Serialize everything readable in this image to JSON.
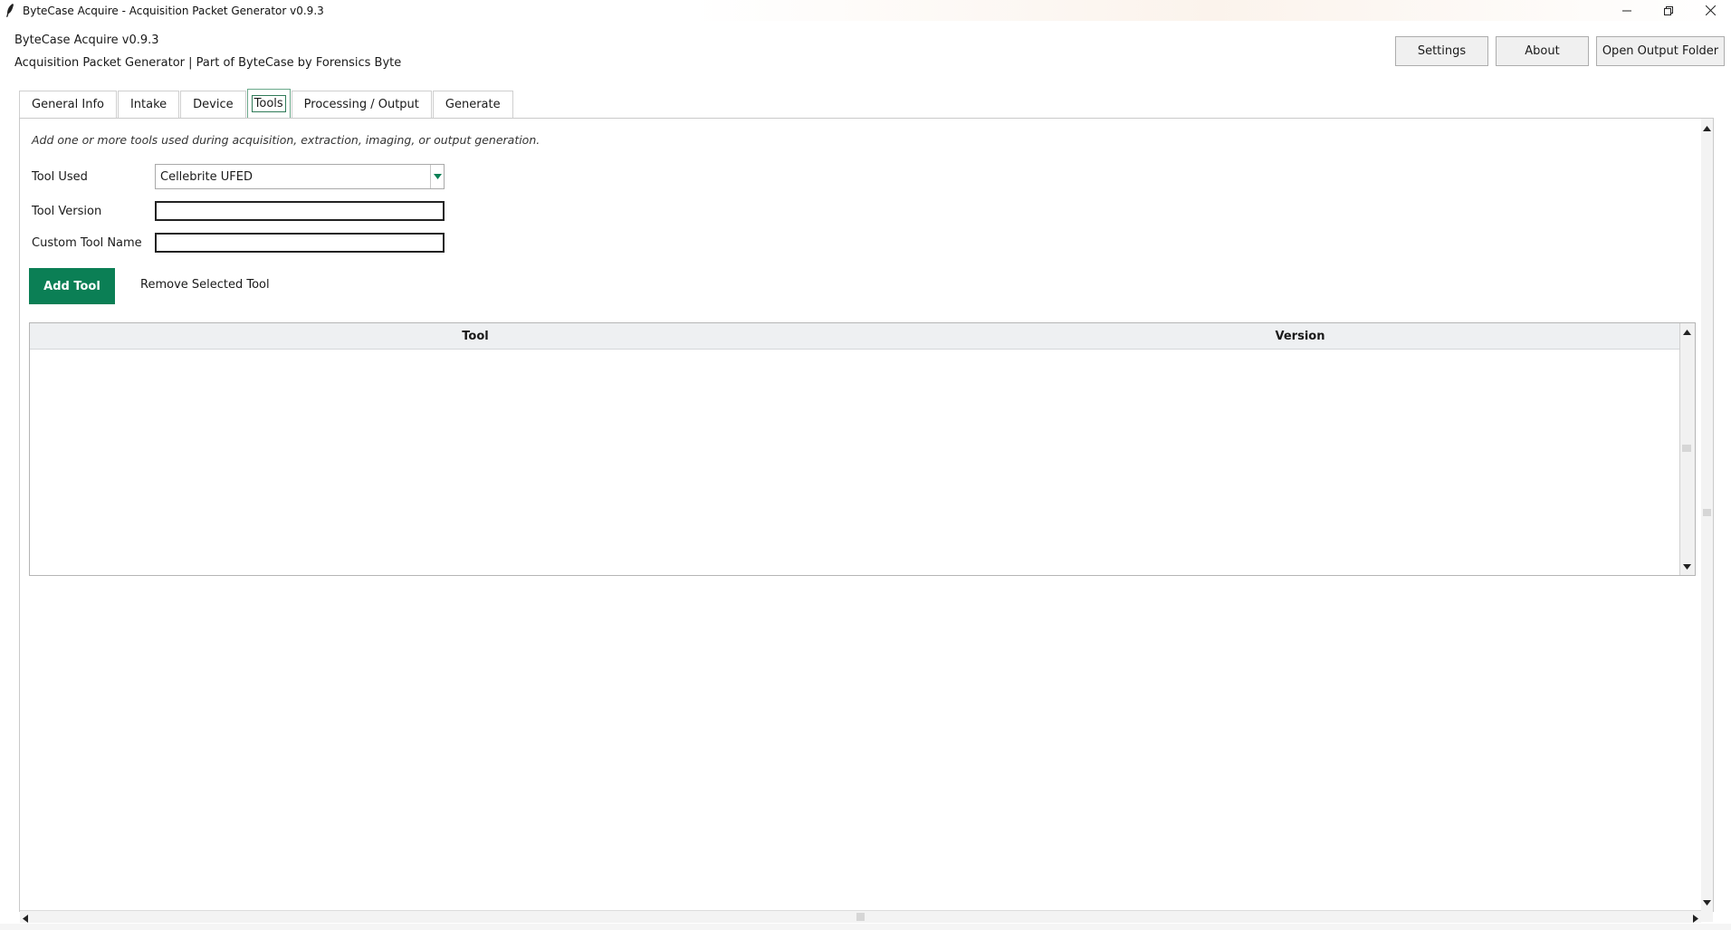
{
  "window": {
    "title": "ByteCase Acquire - Acquisition Packet Generator v0.9.3",
    "icon": "feather-icon",
    "controls": [
      "minimize-icon",
      "restore-icon",
      "close-icon"
    ]
  },
  "header": {
    "app_name": "ByteCase Acquire v0.9.3",
    "subtitle": "Acquisition Packet Generator | Part of ByteCase by Forensics Byte",
    "buttons": {
      "settings": "Settings",
      "about": "About",
      "open_output": "Open Output Folder"
    }
  },
  "tabs": [
    {
      "label": "General Info",
      "active": false
    },
    {
      "label": "Intake",
      "active": false
    },
    {
      "label": "Device",
      "active": false
    },
    {
      "label": "Tools",
      "active": true
    },
    {
      "label": "Processing / Output",
      "active": false
    },
    {
      "label": "Generate",
      "active": false
    }
  ],
  "tools_tab": {
    "hint": "Add one or more tools used during acquisition, extraction, imaging, or output generation.",
    "tool_used": {
      "label": "Tool Used",
      "value": "Cellebrite UFED"
    },
    "tool_version": {
      "label": "Tool Version",
      "value": ""
    },
    "custom_tool_name": {
      "label": "Custom Tool Name",
      "value": ""
    },
    "add_button": "Add Tool",
    "remove_button": "Remove Selected Tool",
    "table": {
      "columns": [
        "Tool",
        "Version"
      ],
      "rows": []
    }
  },
  "colors": {
    "accent": "#0b7f55",
    "active_tab_border": "#2f7a58"
  }
}
